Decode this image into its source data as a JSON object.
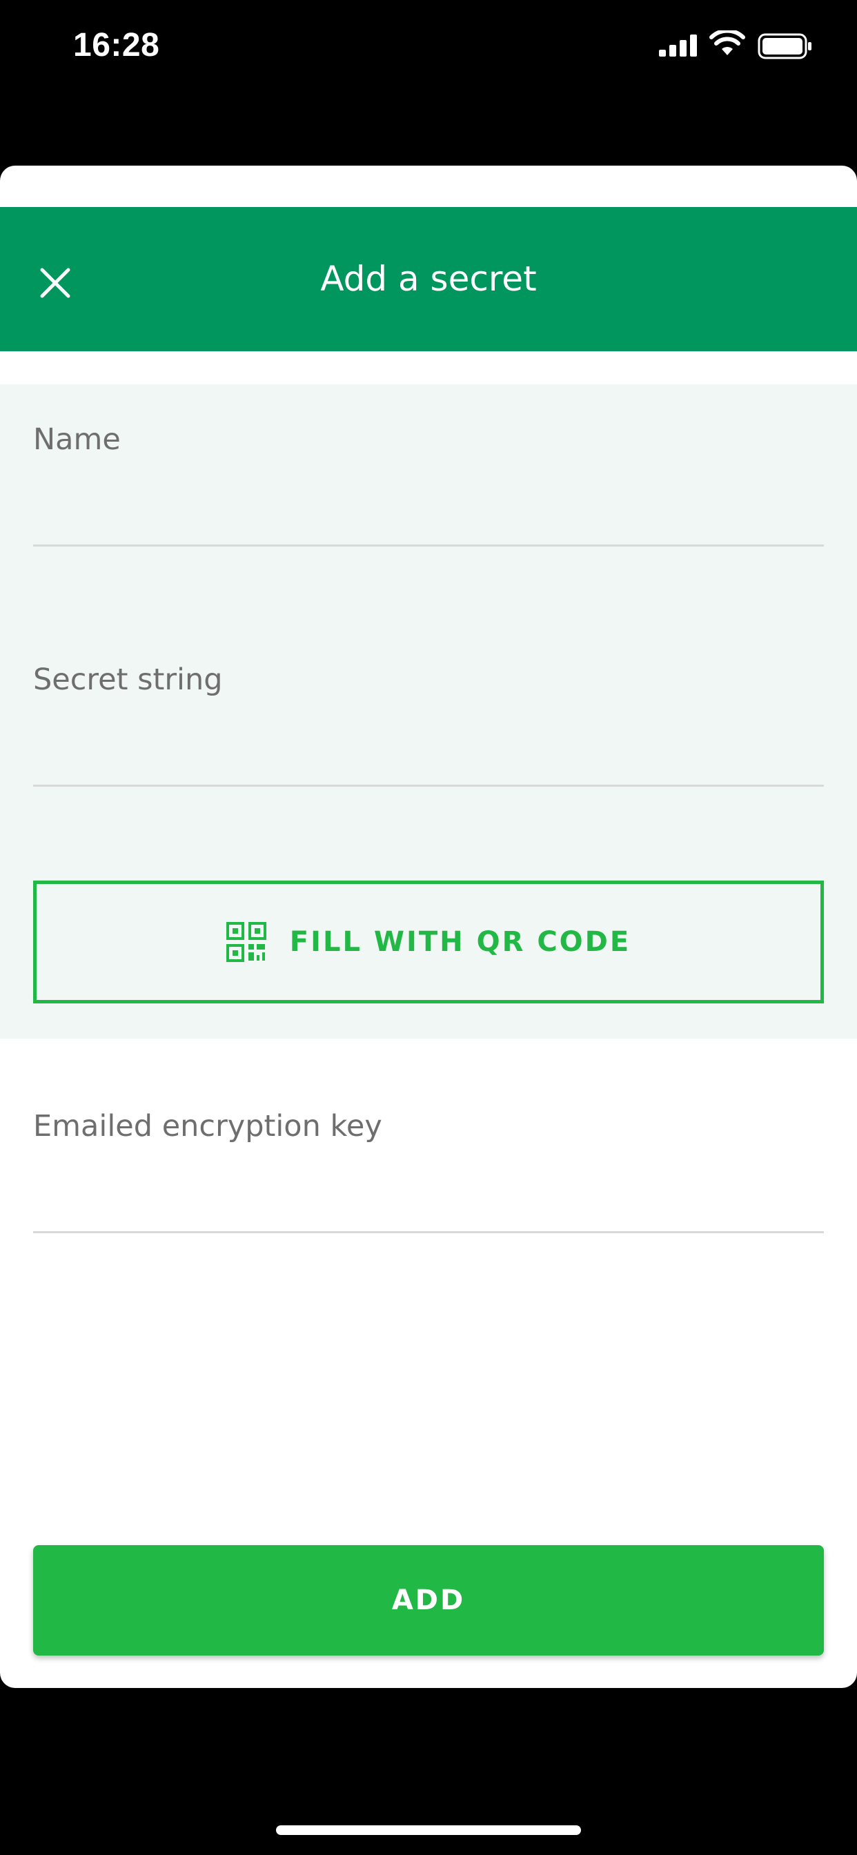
{
  "status_bar": {
    "time": "16:28",
    "icons": [
      "signal-icon",
      "wifi-icon",
      "battery-icon"
    ]
  },
  "header": {
    "title": "Add a secret",
    "close_icon": "close-icon"
  },
  "form": {
    "name": {
      "label": "Name",
      "value": ""
    },
    "secret_string": {
      "label": "Secret string",
      "value": ""
    },
    "qr_button": {
      "label": "FILL WITH QR CODE",
      "icon": "qr-code-icon"
    },
    "encryption_key": {
      "label": "Emailed encryption key",
      "value": ""
    }
  },
  "actions": {
    "add_label": "ADD"
  },
  "colors": {
    "header_bg": "#00965e",
    "accent_green": "#22b845",
    "form_panel_bg": "#f1f7f4",
    "label_gray": "#6e6e6e"
  }
}
